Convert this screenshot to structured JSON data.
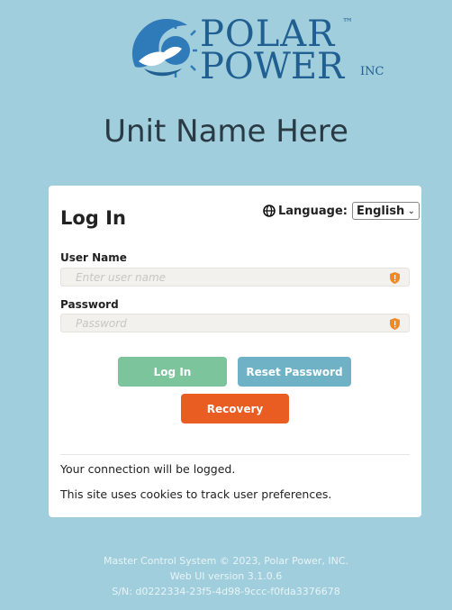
{
  "brand": {
    "logo_line1": "POLAR",
    "logo_tm": "™",
    "logo_line2": "POWER",
    "logo_inc": "INC"
  },
  "unit_name": "Unit Name Here",
  "login": {
    "title": "Log In",
    "language_label": "Language:",
    "language_value": "English",
    "username_label": "User Name",
    "username_placeholder": "Enter user name",
    "password_label": "Password",
    "password_placeholder": "Password",
    "login_button": "Log In",
    "reset_button": "Reset Password",
    "recovery_button": "Recovery",
    "note_logged": "Your connection will be logged.",
    "note_cookies": "This site uses cookies to track user preferences."
  },
  "footer": {
    "line1": "Master Control System © 2023, Polar Power, INC.",
    "line2": "Web UI version 3.1.0.6",
    "line3": "S/N: d0222334-23f5-4d98-9ccc-f0fda3376678"
  },
  "colors": {
    "background": "#a1cedc",
    "login_button": "#7cc49b",
    "reset_button": "#6fb2c6",
    "recovery_button": "#e95d23",
    "shield": "#f08a24"
  }
}
